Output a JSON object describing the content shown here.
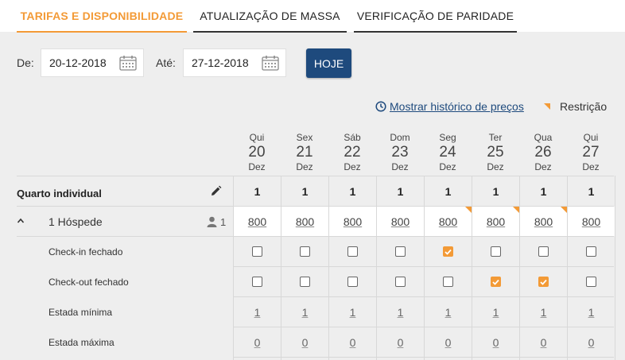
{
  "tabs": [
    {
      "label": "TARIFAS E DISPONIBILIDADE"
    },
    {
      "label": "ATUALIZAÇÃO DE MASSA"
    },
    {
      "label": "VERIFICAÇÃO DE PARIDADE"
    }
  ],
  "dates": {
    "from_label": "De:",
    "from_value": "20-12-2018",
    "to_label": "Até:",
    "to_value": "27-12-2018",
    "today_label": "HOJE"
  },
  "history_link": "Mostrar histórico de preços",
  "restriction_label": "Restrição",
  "colors": {
    "accent": "#f39a36",
    "primary": "#1e4a7d"
  },
  "days": [
    {
      "weekday": "Qui",
      "day": "20",
      "month": "Dez"
    },
    {
      "weekday": "Sex",
      "day": "21",
      "month": "Dez"
    },
    {
      "weekday": "Sáb",
      "day": "22",
      "month": "Dez"
    },
    {
      "weekday": "Dom",
      "day": "23",
      "month": "Dez"
    },
    {
      "weekday": "Seg",
      "day": "24",
      "month": "Dez"
    },
    {
      "weekday": "Ter",
      "day": "25",
      "month": "Dez"
    },
    {
      "weekday": "Qua",
      "day": "26",
      "month": "Dez"
    },
    {
      "weekday": "Qui",
      "day": "27",
      "month": "Dez"
    }
  ],
  "room": {
    "name": "Quarto individual",
    "availability": [
      "1",
      "1",
      "1",
      "1",
      "1",
      "1",
      "1",
      "1"
    ],
    "guest_label": "1 Hóspede",
    "guest_count": "1",
    "prices": [
      "800",
      "800",
      "800",
      "800",
      "800",
      "800",
      "800",
      "800"
    ],
    "restricted_days": [
      false,
      false,
      false,
      false,
      true,
      true,
      true,
      false
    ],
    "checkin_label": "Check-in fechado",
    "checkin_closed": [
      false,
      false,
      false,
      false,
      true,
      false,
      false,
      false
    ],
    "checkout_label": "Check-out fechado",
    "checkout_closed": [
      false,
      false,
      false,
      false,
      false,
      true,
      true,
      false
    ],
    "min_stay_label": "Estada mínima",
    "min_stay": [
      "1",
      "1",
      "1",
      "1",
      "1",
      "1",
      "1",
      "1"
    ],
    "max_stay_label": "Estada máxima",
    "max_stay": [
      "0",
      "0",
      "0",
      "0",
      "0",
      "0",
      "0",
      "0"
    ]
  }
}
